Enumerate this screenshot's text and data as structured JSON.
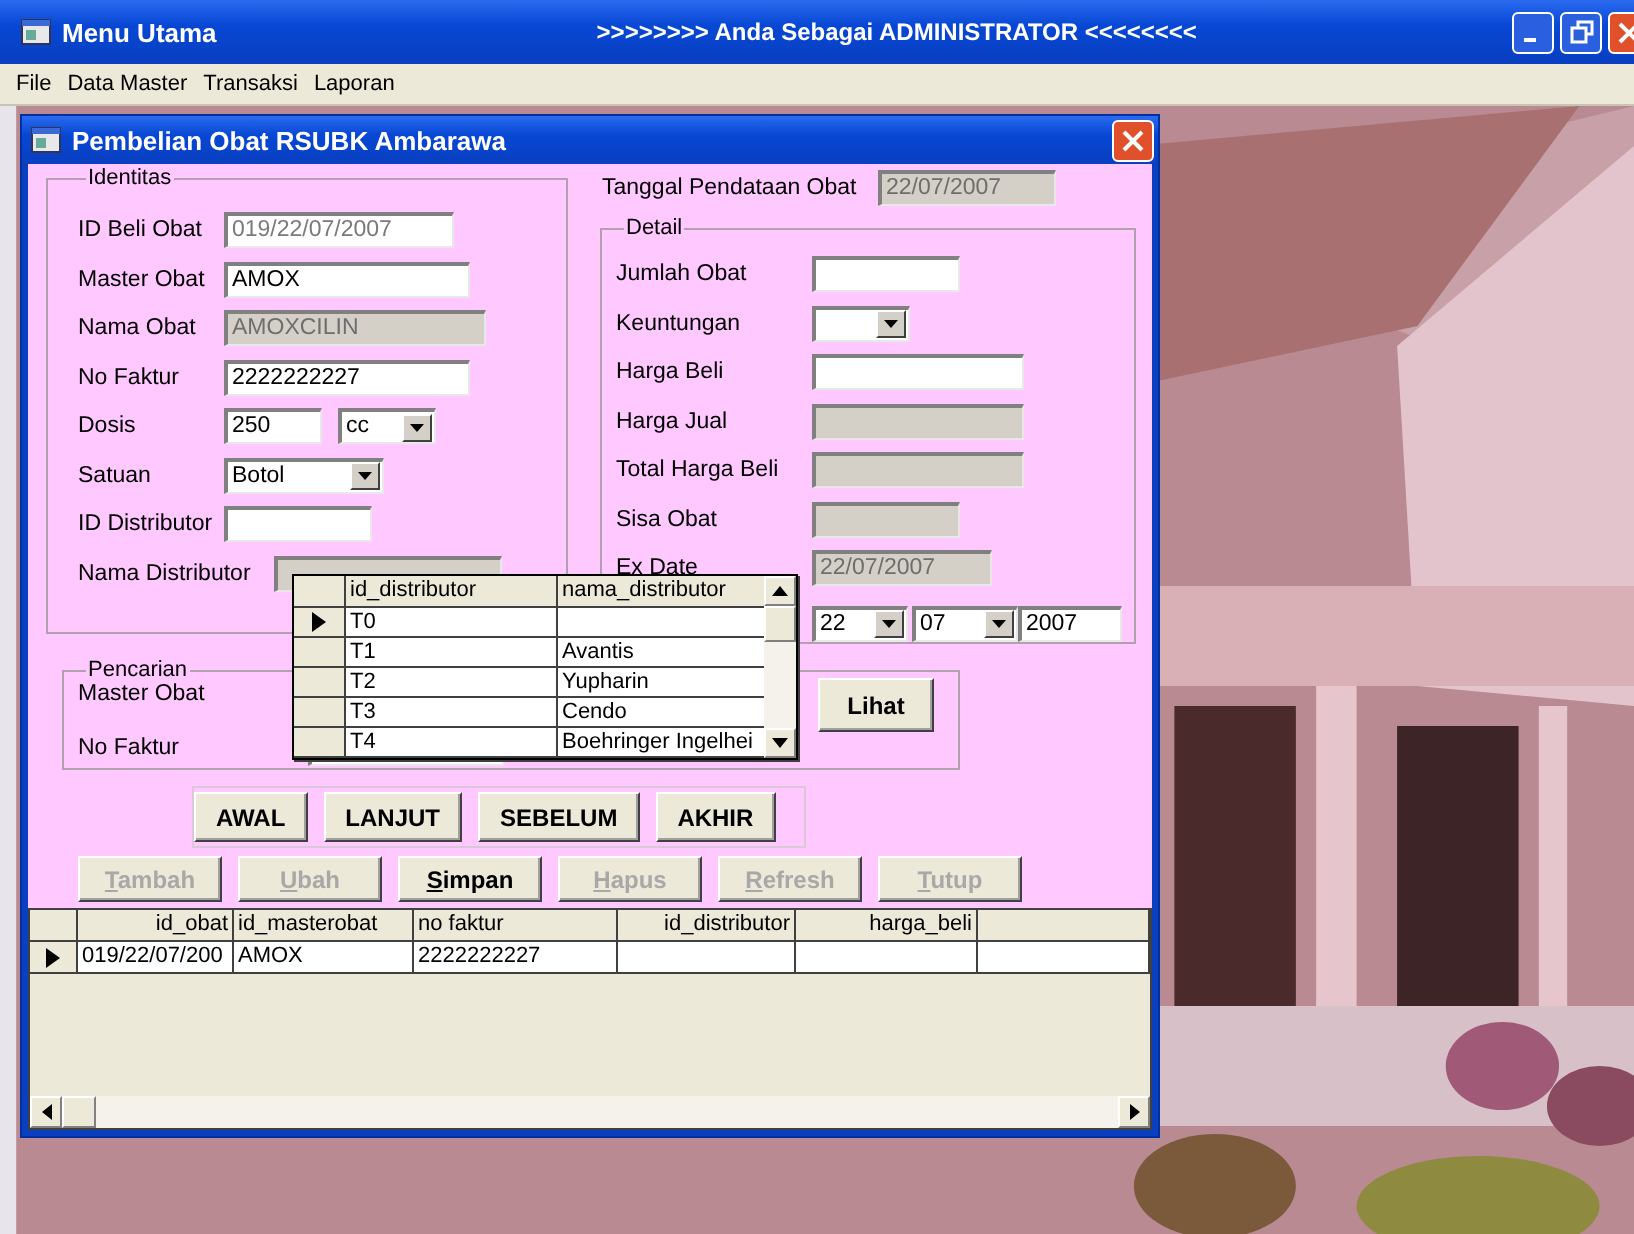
{
  "window": {
    "title": "Menu Utama",
    "banner": ">>>>>>>> Anda Sebagai ADMINISTRATOR <<<<<<<<"
  },
  "menu": [
    "File",
    "Data Master",
    "Transaksi",
    "Laporan"
  ],
  "form": {
    "title": "Pembelian Obat RSUBK Ambarawa",
    "identitas": {
      "legend": "Identitas",
      "fields": [
        {
          "label": "ID Beli Obat",
          "kind": "text",
          "value": "019/22/07/2007",
          "disabled": false,
          "locked": true
        },
        {
          "label": "Master Obat",
          "kind": "text",
          "value": "AMOX",
          "disabled": false
        },
        {
          "label": "Nama Obat",
          "kind": "text",
          "value": "AMOXCILIN",
          "disabled": true
        },
        {
          "label": "No Faktur",
          "kind": "text",
          "value": "2222222227",
          "disabled": false
        },
        {
          "label": "Dosis",
          "kind": "text-combo",
          "value": "250",
          "unit": "cc",
          "disabled": false
        },
        {
          "label": "Satuan",
          "kind": "combo",
          "value": "Botol",
          "disabled": false
        },
        {
          "label": "ID Distributor",
          "kind": "text",
          "disabled": false
        },
        {
          "label": "Nama Distributor",
          "kind": "text",
          "disabled": true
        }
      ]
    },
    "tanggal": {
      "label": "Tanggal Pendataan Obat",
      "value": "22/07/2007",
      "disabled": true
    },
    "detail": {
      "legend": "Detail",
      "fields": [
        {
          "label": "Jumlah Obat",
          "kind": "text",
          "disabled": false
        },
        {
          "label": "Keuntungan",
          "kind": "combo",
          "disabled": false
        },
        {
          "label": "Harga Beli",
          "kind": "text",
          "disabled": false
        },
        {
          "label": "Harga Jual",
          "kind": "text",
          "disabled": true
        },
        {
          "label": "Total Harga Beli",
          "kind": "text",
          "disabled": true
        },
        {
          "label": "Sisa Obat",
          "kind": "text",
          "disabled": true
        },
        {
          "label": "Ex Date",
          "kind": "text",
          "value": "22/07/2007",
          "disabled": true
        }
      ],
      "date": {
        "day": "22",
        "month": "07",
        "year": "2007"
      }
    },
    "pencarian": {
      "legend": "Pencarian",
      "labels": [
        "Master Obat",
        "No Faktur"
      ],
      "button": "Lihat"
    },
    "nav_buttons": [
      "AWAL",
      "LANJUT",
      "SEBELUM",
      "AKHIR"
    ],
    "action_buttons": [
      {
        "label": "Tambah",
        "disabled": true
      },
      {
        "label": "Ubah",
        "disabled": true
      },
      {
        "label": "Simpan",
        "disabled": false
      },
      {
        "label": "Hapus",
        "disabled": true
      },
      {
        "label": "Refresh",
        "disabled": true
      },
      {
        "label": "Tutup",
        "disabled": true
      }
    ],
    "table": {
      "columns": [
        "id_obat",
        "id_masterobat",
        "no faktur",
        "id_distributor",
        "harga_beli"
      ],
      "rows": [
        {
          "selected": true,
          "cells": [
            "019/22/07/200",
            "AMOX",
            "2222222227",
            "",
            ""
          ]
        }
      ]
    },
    "lookup": {
      "columns": [
        "id_distributor",
        "nama_distributor"
      ],
      "rows": [
        {
          "selected": true,
          "cells": [
            "T0",
            ""
          ]
        },
        {
          "selected": false,
          "cells": [
            "T1",
            "Avantis"
          ]
        },
        {
          "selected": false,
          "cells": [
            "T2",
            "Yupharin"
          ]
        },
        {
          "selected": false,
          "cells": [
            "T3",
            "Cendo"
          ]
        },
        {
          "selected": false,
          "cells": [
            "T4",
            "Boehringer Ingelhei"
          ]
        }
      ]
    }
  }
}
